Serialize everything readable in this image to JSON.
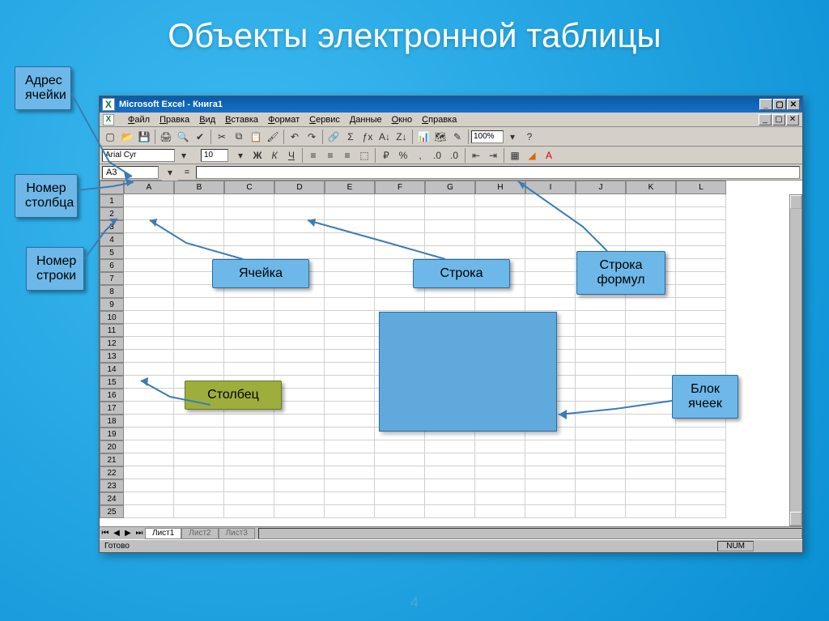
{
  "slide": {
    "title": "Объекты электронной таблицы",
    "page_number": "4"
  },
  "callouts": {
    "cell_address": "Адрес ячейки",
    "column_number": "Номер столбца",
    "row_number": "Номер строки",
    "cell": "Ячейка",
    "row": "Строка",
    "formula_bar": "Строка формул",
    "column": "Столбец",
    "cell_block": "Блок ячеек"
  },
  "excel": {
    "title": "Microsoft Excel - Книга1",
    "menu": [
      "Файл",
      "Правка",
      "Вид",
      "Вставка",
      "Формат",
      "Сервис",
      "Данные",
      "Окно",
      "Справка"
    ],
    "zoom": "100%",
    "font_name": "Arial Cyr",
    "font_size": "10",
    "name_box": "A3",
    "fx_symbol": "=",
    "sheet_tabs": [
      "Лист1",
      "Лист2",
      "Лист3"
    ],
    "status": "Готово",
    "num_indicator": "NUM",
    "columns": [
      "A",
      "B",
      "C",
      "D",
      "E",
      "F",
      "G",
      "H",
      "I",
      "J",
      "K",
      "L"
    ],
    "row_count": 25
  }
}
